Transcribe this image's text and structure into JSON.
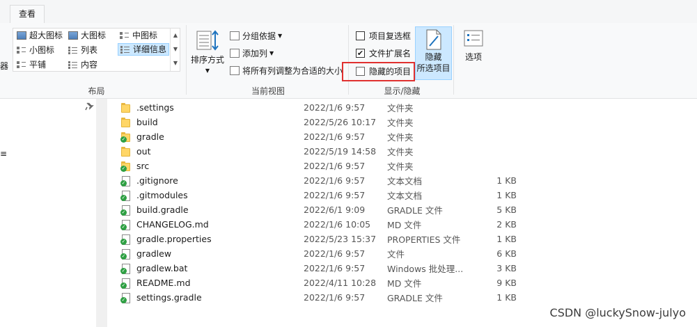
{
  "tabs": {
    "view": "查看"
  },
  "layout": {
    "items": [
      "超大图标",
      "大图标",
      "中图标",
      "小图标",
      "列表",
      "详细信息",
      "平铺",
      "内容"
    ],
    "group_label": "布局"
  },
  "current_view": {
    "sort_label": "排序方式",
    "group_by_label": "分组依据",
    "add_column_label": "添加列",
    "fit_columns_label": "将所有列调整为合适的大小",
    "group_label": "当前视图"
  },
  "show_hide": {
    "item_checkboxes": {
      "label": "项目复选框",
      "checked": false
    },
    "file_extensions": {
      "label": "文件扩展名",
      "checked": true
    },
    "hidden_items": {
      "label": "隐藏的项目",
      "checked": false
    },
    "hide_selected_label_line1": "隐藏",
    "hide_selected_label_line2": "所选项目",
    "group_label": "显示/隐藏"
  },
  "options_label": "选项",
  "left_fragments": [
    "器",
    "≡"
  ],
  "files": [
    {
      "name": ".settings",
      "date": "2022/1/6 9:57",
      "type": "文件夹",
      "size": "",
      "icon": "folder-icon",
      "git": false
    },
    {
      "name": "build",
      "date": "2022/5/26 10:17",
      "type": "文件夹",
      "size": "",
      "icon": "folder-icon",
      "git": false
    },
    {
      "name": "gradle",
      "date": "2022/1/6 9:57",
      "type": "文件夹",
      "size": "",
      "icon": "folder-icon",
      "git": true
    },
    {
      "name": "out",
      "date": "2022/5/19 14:58",
      "type": "文件夹",
      "size": "",
      "icon": "folder-icon",
      "git": false
    },
    {
      "name": "src",
      "date": "2022/1/6 9:57",
      "type": "文件夹",
      "size": "",
      "icon": "folder-icon",
      "git": true
    },
    {
      "name": ".gitignore",
      "date": "2022/1/6 9:57",
      "type": "文本文档",
      "size": "1 KB",
      "icon": "file-icon",
      "git": true
    },
    {
      "name": ".gitmodules",
      "date": "2022/1/6 9:57",
      "type": "文本文档",
      "size": "1 KB",
      "icon": "file-icon",
      "git": true
    },
    {
      "name": "build.gradle",
      "date": "2022/6/1 9:09",
      "type": "GRADLE 文件",
      "size": "5 KB",
      "icon": "file-icon",
      "git": true
    },
    {
      "name": "CHANGELOG.md",
      "date": "2022/1/6 10:05",
      "type": "MD 文件",
      "size": "2 KB",
      "icon": "file-icon",
      "git": true
    },
    {
      "name": "gradle.properties",
      "date": "2022/5/23 15:37",
      "type": "PROPERTIES 文件",
      "size": "1 KB",
      "icon": "file-icon",
      "git": true
    },
    {
      "name": "gradlew",
      "date": "2022/1/6 9:57",
      "type": "文件",
      "size": "6 KB",
      "icon": "file-icon",
      "git": true
    },
    {
      "name": "gradlew.bat",
      "date": "2022/1/6 9:57",
      "type": "Windows 批处理...",
      "size": "3 KB",
      "icon": "file-icon",
      "git": true
    },
    {
      "name": "README.md",
      "date": "2022/4/11 10:28",
      "type": "MD 文件",
      "size": "9 KB",
      "icon": "file-icon",
      "git": true
    },
    {
      "name": "settings.gradle",
      "date": "2022/1/6 9:57",
      "type": "GRADLE 文件",
      "size": "1 KB",
      "icon": "file-icon",
      "git": true
    }
  ],
  "watermark": "CSDN @luckySnow-julyo",
  "colors": {
    "selected_bg": "#cce8ff",
    "highlight_border": "#e0302f",
    "folder": "#ffd667",
    "git_badge": "#2ea043"
  }
}
